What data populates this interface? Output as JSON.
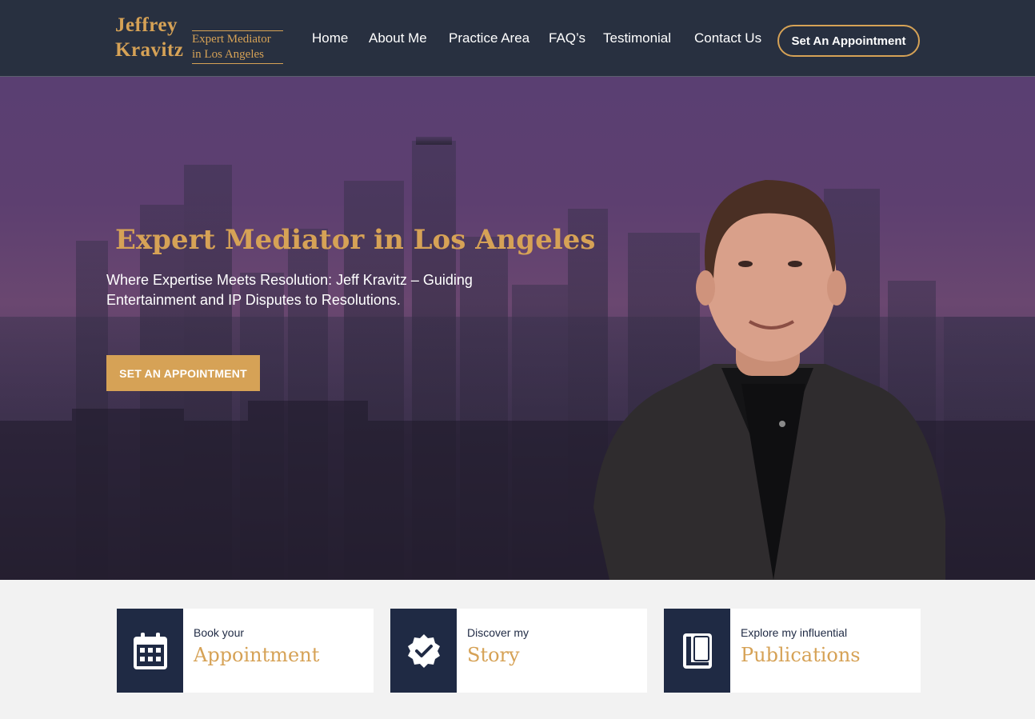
{
  "header": {
    "logo": {
      "first": "Jeffrey",
      "last": "Kravitz",
      "line1": "Expert Mediator",
      "line2": "in Los Angeles"
    },
    "nav": [
      "Home",
      "About Me",
      "Practice Area",
      "FAQ’s",
      "Testimonial",
      "Contact Us"
    ],
    "cta": "Set An Appointment"
  },
  "hero": {
    "title": "Expert Mediator in Los Angeles",
    "subtitle": "Where Expertise Meets Resolution: Jeff Kravitz – Guiding Entertainment and IP Disputes to Resolutions.",
    "button": "SET AN APPOINTMENT"
  },
  "cards": [
    {
      "small": "Book your",
      "big": "Appointment",
      "icon": "calendar-icon"
    },
    {
      "small": "Discover my",
      "big": "Story",
      "icon": "verified-badge-icon"
    },
    {
      "small": "Explore my influential",
      "big": "Publications",
      "icon": "book-icon"
    }
  ],
  "colors": {
    "navy": "#283040",
    "gold": "#d6a256",
    "card_icon_bg": "#1f2a44"
  }
}
